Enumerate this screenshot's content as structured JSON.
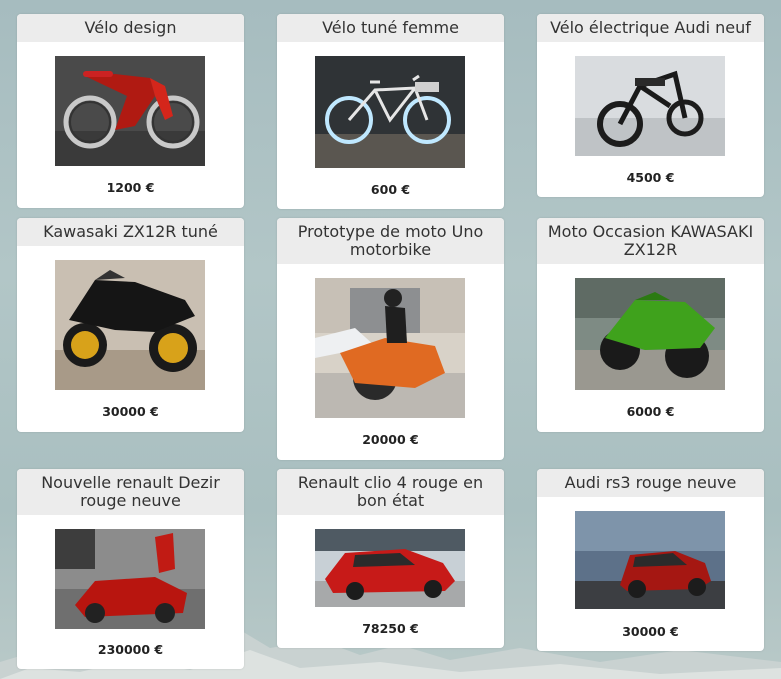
{
  "listings": [
    {
      "title": "Vélo design",
      "price": "1200 €",
      "image": "red design bicycle"
    },
    {
      "title": "Vélo tuné femme",
      "price": "600 €",
      "image": "white bicycle with glowing wheels"
    },
    {
      "title": "Vélo électrique Audi neuf",
      "price": "4500 €",
      "image": "black electric bike"
    },
    {
      "title": "Kawasaki ZX12R tuné",
      "price": "30000 €",
      "image": "black tuned motorbike"
    },
    {
      "title": "Prototype de moto Uno motorbike",
      "price": "20000 €",
      "image": "orange prototype motorbike with rider"
    },
    {
      "title": "Moto Occasion KAWASAKI ZX12R",
      "price": "6000 €",
      "image": "green sport motorbike"
    },
    {
      "title": "Nouvelle renault Dezir rouge neuve",
      "price": "230000 €",
      "image": "red concept car"
    },
    {
      "title": "Renault clio 4 rouge en bon état",
      "price": "78250 €",
      "image": "red compact car"
    },
    {
      "title": "Audi rs3 rouge neuve",
      "price": "30000 €",
      "image": "red hatchback at sunset"
    }
  ]
}
